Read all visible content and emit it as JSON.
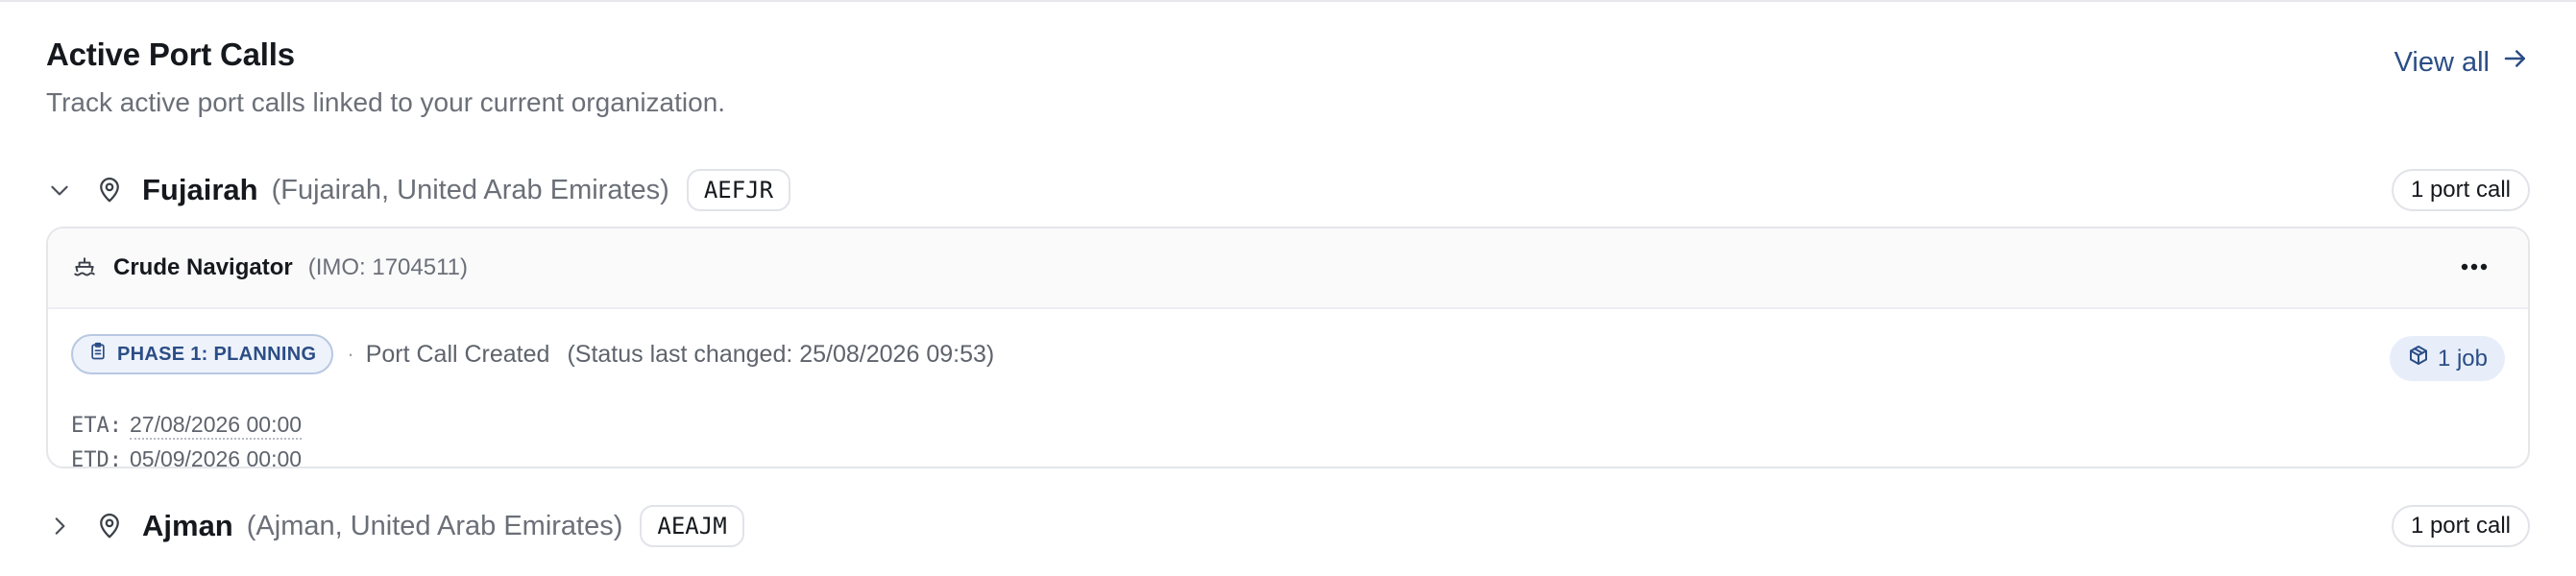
{
  "header": {
    "title": "Active Port Calls",
    "subtitle": "Track active port calls linked to your current organization.",
    "view_all_label": "View all"
  },
  "ports": [
    {
      "name": "Fujairah",
      "location": "(Fujairah, United Arab Emirates)",
      "code": "AEFJR",
      "count_label": "1 port call",
      "expanded": true,
      "vessels": [
        {
          "name": "Crude Navigator",
          "imo": "(IMO: 1704511)",
          "phase_label": "PHASE 1: PLANNING",
          "separator": "·",
          "status": "Port Call Created",
          "status_changed": "(Status last changed: 25/08/2026 09:53)",
          "job_label": "1 job",
          "eta_key": "ETA:",
          "eta_value": "27/08/2026 00:00",
          "etd_key": "ETD:",
          "etd_value": "05/09/2026 00:00"
        }
      ]
    },
    {
      "name": "Ajman",
      "location": "(Ajman, United Arab Emirates)",
      "code": "AEAJM",
      "count_label": "1 port call",
      "expanded": false
    }
  ],
  "icons": {
    "view_all": "arrow-right-icon",
    "expanded": "chevron-down-icon",
    "collapsed": "chevron-right-icon",
    "location": "map-pin-icon",
    "vessel": "ship-icon",
    "menu": "more-horizontal-icon",
    "phase": "clipboard-icon",
    "job": "package-icon"
  },
  "colors": {
    "accent": "#2b4d86",
    "phase_bg": "#eef3fb",
    "job_bg": "#e7eefa",
    "muted_text": "#6b6f78"
  }
}
